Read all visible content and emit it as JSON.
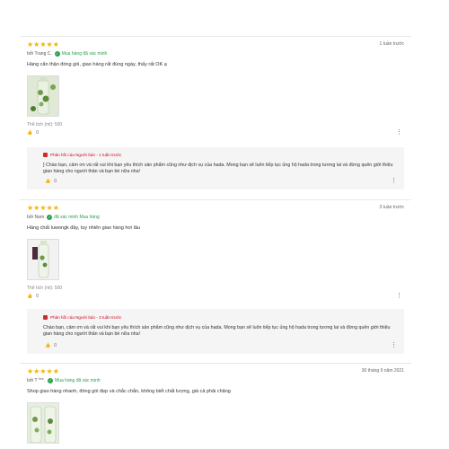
{
  "reviews": [
    {
      "stars": "★★★★★",
      "time": "1 tuần trước",
      "author": "bởi Trang C.",
      "verified": "Mua hàng đã xác minh",
      "text": "Hàng cẩn thận đóng gói, giao hàng rất đúng ngày, thấy rất OK ạ",
      "volume": "Thể tích (ml): 500",
      "likes": "0",
      "reply": {
        "header": "Phản hồi của Người bán - 1 tuần trước",
        "text": "] Chào bạn, cảm ơn và rất vui khi bạn yêu thích sản phẩm cũng như dịch vụ của hada.  Mong bạn sẽ luôn tiếp tục ủng hộ  hada  trong tương lai và đừng quên giới thiệu gian hàng cho người thân và bạn bè nữa nha!",
        "likes": "0"
      }
    },
    {
      "stars": "★★★★★",
      "time": "3 tuần trước",
      "author": "bởi Nam",
      "verified": "đã xác minh Mua hàng",
      "text": "Hàng chất luwongk đầy, tuy nhiên giao hàng hơi lâu",
      "volume": "Thể tích (ml): 500",
      "likes": "0",
      "reply": {
        "header": "Phản hồi của Người bán - 3 tuần trước",
        "text": "Chào bạn, cảm ơn và rất vui khi bạn yêu thích sản phẩm cũng như dịch vụ của hada.  Mong bạn sẽ luôn tiếp tục ủng hộ  hada  trong tương lai và đừng quên giới thiệu gian hàng cho người thân và bạn bè nữa nha!",
        "likes": "0"
      }
    },
    {
      "stars": "★★★★★",
      "time": "30 tháng 9 năm 2021",
      "author": "bởi T ***.",
      "verified": "Mua hàng đã xác minh",
      "text": "Shop giao hàng nhanh, đóng gói đẹp và chắc chắn, không biết chất lượng, giá cả phải chăng"
    }
  ],
  "icons": {
    "like": "thumbs-up-icon",
    "more": "more-vertical-icon",
    "verified": "check-circle-icon",
    "shop": "shop-icon"
  },
  "colors": {
    "star": "#f5b301",
    "verified": "#2aa14a",
    "seller": "#d0011b",
    "reply_bg": "#f5f5f5"
  }
}
